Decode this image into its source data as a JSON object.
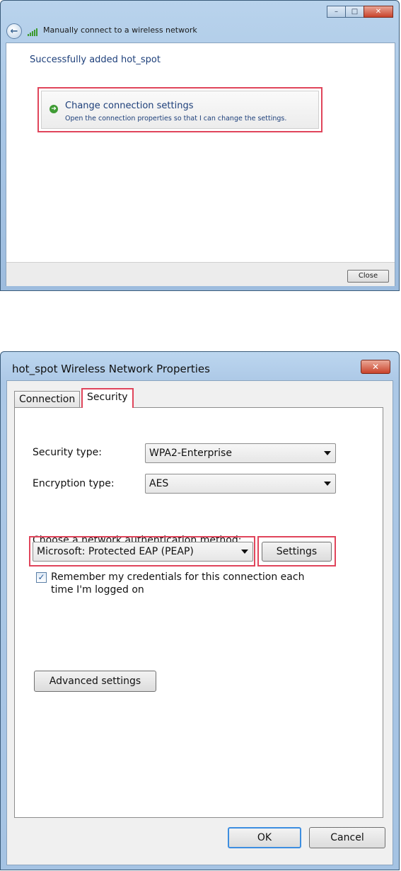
{
  "wizard": {
    "title": "Manually connect to a wireless network",
    "success_message": "Successfully added hot_spot",
    "command_link": {
      "title": "Change connection settings",
      "description": "Open the connection properties so that I can change the settings."
    },
    "close_label": "Close",
    "caption": {
      "minimize": "–",
      "maximize": "□",
      "close": "✕"
    }
  },
  "properties": {
    "title": "hot_spot Wireless Network Properties",
    "close_glyph": "✕",
    "tabs": [
      {
        "label": "Connection"
      },
      {
        "label": "Security"
      }
    ],
    "security_type_label": "Security type:",
    "security_type_value": "WPA2-Enterprise",
    "encryption_type_label": "Encryption type:",
    "encryption_type_value": "AES",
    "auth_method_label": "Choose a network authentication method:",
    "auth_method_value": "Microsoft: Protected EAP (PEAP)",
    "settings_label": "Settings",
    "remember_line1": "Remember my credentials for this connection each",
    "remember_line2": "time I'm logged on",
    "remember_checked": true,
    "advanced_label": "Advanced settings",
    "ok_label": "OK",
    "cancel_label": "Cancel"
  },
  "colors": {
    "highlight": "#e0455b",
    "link_text": "#1d3f7a",
    "window_frame": "#a9c7e6"
  },
  "icons": [
    "back-arrow-icon",
    "wireless-signal-icon",
    "green-arrow-icon",
    "checkmark-icon",
    "dropdown-arrow-icon"
  ]
}
